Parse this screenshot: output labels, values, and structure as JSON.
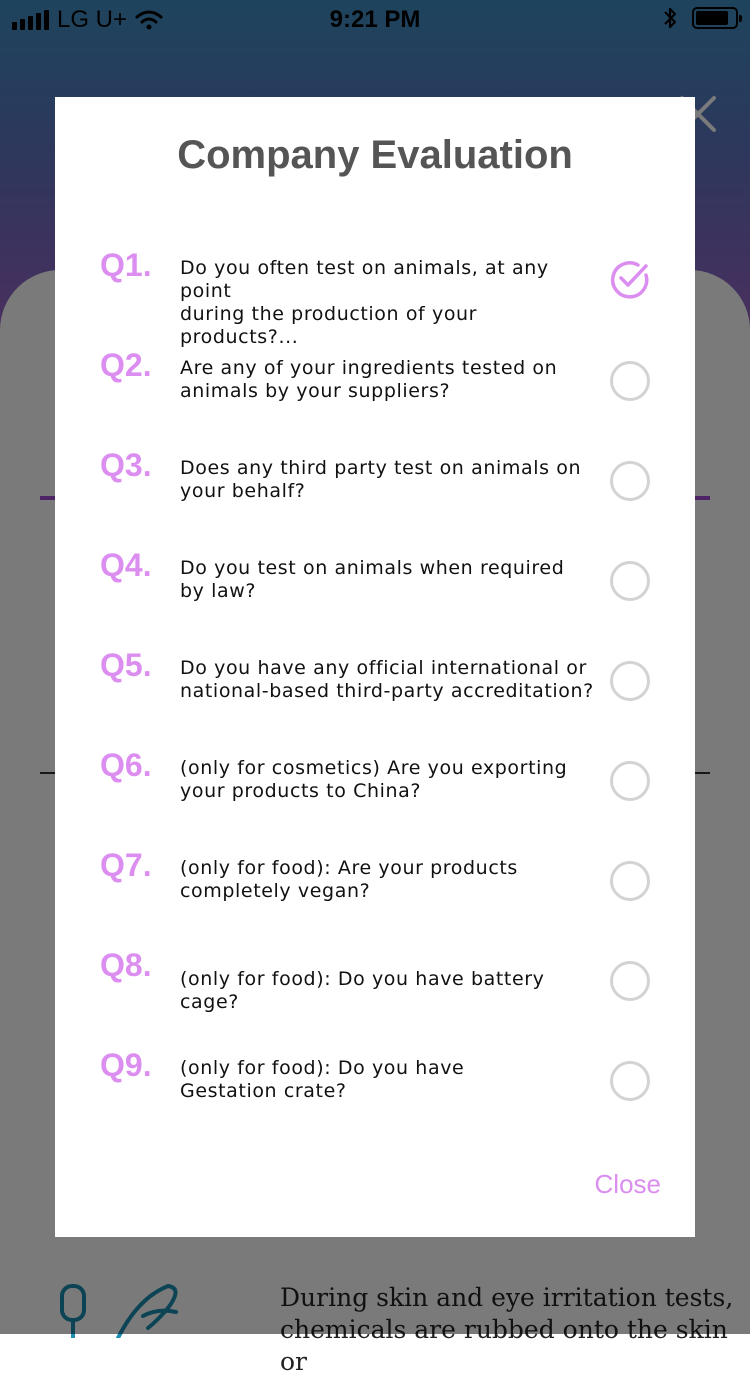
{
  "status_bar": {
    "carrier": "LG U+",
    "time": "9:21 PM",
    "battery_level": 0.85
  },
  "background": {
    "body_text": "During skin and eye irritation tests, chemicals are rubbed onto the skin or"
  },
  "modal": {
    "title": "Company Evaluation",
    "close_label": "Close",
    "accent_color": "#dc8ef0",
    "questions": [
      {
        "number": "Q1.",
        "text": "Do you often test on animals, at any point\nduring the production of your products?...",
        "checked": true
      },
      {
        "number": "Q2.",
        "text": "Are any of your ingredients tested on\nanimals by your suppliers?",
        "checked": false
      },
      {
        "number": "Q3.",
        "text": "Does any third party test on animals on\nyour behalf?",
        "checked": false
      },
      {
        "number": "Q4.",
        "text": "Do you test on animals when required\nby law?",
        "checked": false
      },
      {
        "number": "Q5.",
        "text": "Do you have any official international or\nnational-based third-party accreditation?",
        "checked": false
      },
      {
        "number": "Q6.",
        "text": "(only for cosmetics) Are you exporting\nyour products to China?",
        "checked": false
      },
      {
        "number": "Q7.",
        "text": "(only for food): Are your products\ncompletely vegan?",
        "checked": false
      },
      {
        "number": "Q8.",
        "text": "(only for food): Do you have battery cage?",
        "checked": false
      },
      {
        "number": "Q9.",
        "text": "(only for food): Do you have\nGestation crate?",
        "checked": false
      }
    ]
  }
}
